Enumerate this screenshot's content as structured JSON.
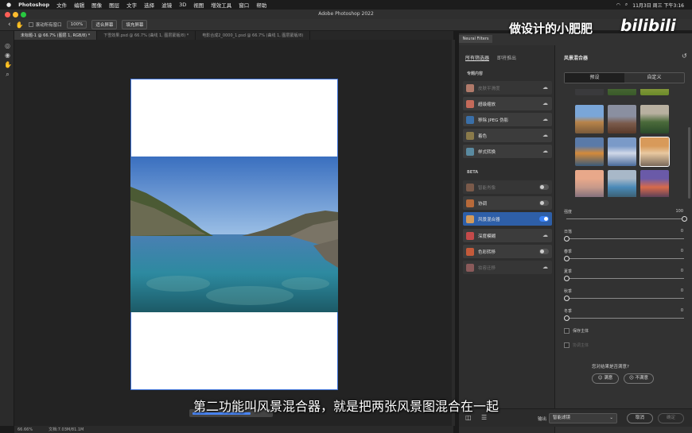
{
  "menubar": {
    "items": [
      "Photoshop",
      "文件",
      "编辑",
      "图像",
      "图层",
      "文字",
      "选择",
      "滤镜",
      "3D",
      "视图",
      "增效工具",
      "窗口",
      "帮助"
    ],
    "datetime": "11月3日 周三 下午3:16"
  },
  "window_title": "Adobe Photoshop 2022",
  "options": {
    "scroll_all": "滚动所有窗口",
    "zoom": "100%",
    "fit": "适合屏幕",
    "fill": "填充屏幕"
  },
  "tabs": [
    "未标题-1 @ 66.7% (图层 1, RGB/8) *",
    "下雪效果.psd @ 66.7% (曲线 1, 图层蒙版/8) *",
    "电影合成2_0000_1.psd @ 66.7% (曲线 1, 图层蒙版/8)"
  ],
  "status": {
    "zoom": "66.66%",
    "doc": "文档:7.03M/81.1M"
  },
  "progress_fraction": 0.75,
  "neural_filters": {
    "tab_label": "Neural Filters",
    "all_filters": "所有筛选器",
    "waitlist": "即将推出",
    "featured_heading": "专题内容",
    "featured": [
      {
        "name": "皮肤平滑度",
        "state": "disabled"
      },
      {
        "name": "超级缩放",
        "state": "download"
      },
      {
        "name": "移除 JPEG 伪影",
        "state": "download"
      },
      {
        "name": "着色",
        "state": "download"
      },
      {
        "name": "样式转换",
        "state": "download"
      }
    ],
    "beta_heading": "BETA",
    "beta": [
      {
        "name": "智能肖像",
        "state": "disabled-off"
      },
      {
        "name": "协调",
        "state": "off"
      },
      {
        "name": "风景混合器",
        "state": "on"
      },
      {
        "name": "深度模糊",
        "state": "download"
      },
      {
        "name": "色彩转移",
        "state": "off"
      },
      {
        "name": "妆容迁移",
        "state": "disabled-download"
      }
    ],
    "panel_title": "风景混合器",
    "seg_preset": "预设",
    "seg_custom": "自定义",
    "sliders": [
      {
        "label": "强度",
        "value": "100",
        "fraction": 1.0
      },
      {
        "label": "日落",
        "value": "0",
        "fraction": 0
      },
      {
        "label": "春季",
        "value": "0",
        "fraction": 0
      },
      {
        "label": "夏季",
        "value": "0",
        "fraction": 0
      },
      {
        "label": "秋季",
        "value": "0",
        "fraction": 0
      },
      {
        "label": "冬季",
        "value": "0",
        "fraction": 0
      }
    ],
    "checkboxes": [
      {
        "label": "保存主体",
        "disabled": false
      },
      {
        "label": "协调主体",
        "disabled": true
      }
    ],
    "feedback_q": "您对结果是否满意?",
    "satisfied": "满意",
    "unsatisfied": "不满意",
    "output_label": "输出",
    "output_value": "智能滤镜",
    "cancel": "取消",
    "ok": "确定"
  },
  "subtitle": "第二功能叫风景混合器，就是把两张风景图混合在一起",
  "watermark": "做设计的小肥肥",
  "watermark_logo": "bilibili",
  "colors": {
    "accent": "#3b82f6",
    "selected": "#2e5fa8"
  }
}
